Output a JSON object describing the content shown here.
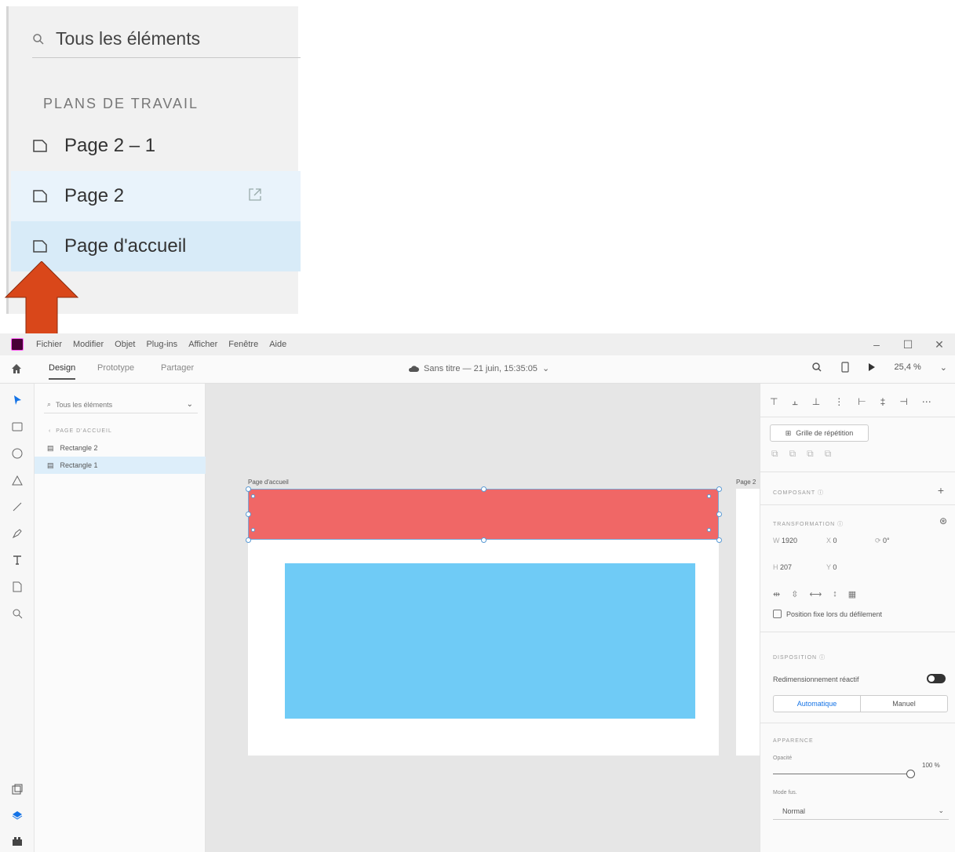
{
  "inset": {
    "search_placeholder": "Tous les éléments",
    "section_label": "PLANS DE TRAVAIL",
    "items": [
      {
        "label": "Page 2 – 1"
      },
      {
        "label": "Page 2"
      },
      {
        "label": "Page d'accueil"
      }
    ]
  },
  "colors": {
    "arrow": "#d9471a",
    "red_rect": "#f06766",
    "blue_rect": "#6fcbf6",
    "selection": "#5b9bd5"
  },
  "menu": [
    "Fichier",
    "Modifier",
    "Objet",
    "Plug-ins",
    "Afficher",
    "Fenêtre",
    "Aide"
  ],
  "window_controls": [
    "–",
    "☐",
    "✕"
  ],
  "tabs": [
    "Design",
    "Prototype",
    "Partager"
  ],
  "document_title": "Sans titre — 21 juin, 15:35:05",
  "zoom": "25,4 %",
  "layers": {
    "search_placeholder": "Tous les éléments",
    "group_label": "PAGE D'ACCUEIL",
    "items": [
      {
        "label": "Rectangle 2"
      },
      {
        "label": "Rectangle 1"
      }
    ]
  },
  "canvas": {
    "artboard_label": "Page d'accueil",
    "artboard2_label": "Page 2"
  },
  "props": {
    "repeat_grid": "Grille de répétition",
    "component_label": "COMPOSANT",
    "transform_label": "TRANSFORMATION",
    "w": "1920",
    "x": "0",
    "rotation": "0°",
    "h": "207",
    "y": "0",
    "fixed_position": "Position fixe lors du défilement",
    "layout_label": "DISPOSITION",
    "responsive_label": "Redimensionnement réactif",
    "auto_label": "Automatique",
    "manual_label": "Manuel",
    "appearance_label": "APPARENCE",
    "opacity_label": "Opacité",
    "opacity_value": "100 %",
    "blend_label": "Mode fus.",
    "blend_value": "Normal"
  }
}
